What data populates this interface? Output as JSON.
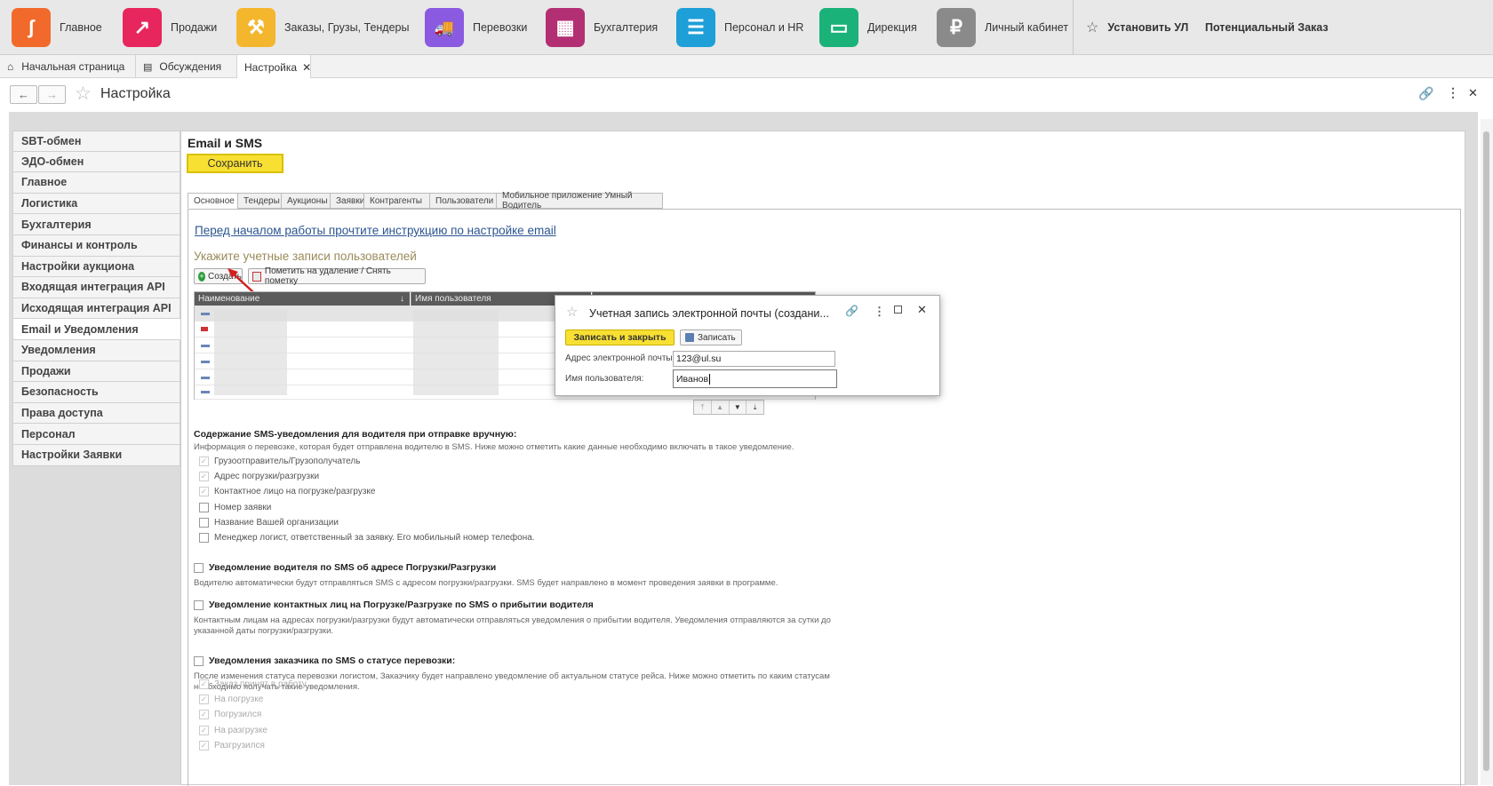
{
  "topbar": {
    "modules": [
      {
        "label": "Главное",
        "icon": "swirl-logo-icon",
        "color": "#f26a2b",
        "glyph": "ʃ"
      },
      {
        "label": "Продажи",
        "icon": "chart-up-icon",
        "color": "#e8265e",
        "glyph": "↗"
      },
      {
        "label": "Заказы,  Грузы, Тендеры",
        "icon": "gavel-icon",
        "color": "#f4b62d",
        "glyph": "⚒"
      },
      {
        "label": "Перевозки",
        "icon": "truck-icon",
        "color": "#8a5be0",
        "glyph": "🚚"
      },
      {
        "label": "Бухгалтерия",
        "icon": "calculator-icon",
        "color": "#b32f73",
        "glyph": "▦"
      },
      {
        "label": "Персонал и HR",
        "icon": "id-card-icon",
        "color": "#1e9fd8",
        "glyph": "☰"
      },
      {
        "label": "Дирекция",
        "icon": "briefcase-icon",
        "color": "#1bb27a",
        "glyph": "▭"
      },
      {
        "label": "Личный кабинет",
        "icon": "lock-ruble-icon",
        "color": "#8a8a8a",
        "glyph": "₽"
      }
    ],
    "install_label": "Установить УЛ",
    "potential_label": "Потенциальный Заказ"
  },
  "open_tabs": [
    "Начальная страница",
    "Обсуждения",
    "Настройка"
  ],
  "header": {
    "title": "Настройка"
  },
  "sidebar": {
    "items": [
      "SBT-обмен",
      "ЭДО-обмен",
      "Главное",
      "Логистика",
      "Бухгалтерия",
      "Финансы и контроль",
      "Настройки аукциона",
      "Входящая интеграция API",
      "Исходящая интеграция API",
      "Email и Уведомления",
      "Уведомления",
      "Продажи",
      "Безопасность",
      "Права доступа",
      "Персонал",
      "Настройки Заявки"
    ],
    "active_index": 9
  },
  "form": {
    "title": "Email и SMS",
    "save_label": "Сохранить",
    "tabs": [
      "Основное",
      "Тендеры",
      "Аукционы",
      "Заявки",
      "Контрагенты",
      "Пользователи",
      "Мобильное приложение Умный Водитель"
    ],
    "instruction_link": "Перед началом работы прочтите инструкцию по настройке email",
    "accounts_heading": "Укажите учетные записи пользователей",
    "create_label": "Создать",
    "mark_label": "Пометить на удаление / Снять пометку",
    "table_columns": [
      "Наименование",
      "Имя пользователя"
    ],
    "sms_heading": "Содержание SMS-уведомления для водителя при отправке вручную:",
    "sms_note": "Информация о перевозке, которая будет отправлена водителю в SMS. Ниже можно отметить какие данные необходимо включать в такое уведомление.",
    "sms_options": [
      {
        "label": "Грузоотправитель/Грузополучатель",
        "checked": true
      },
      {
        "label": "Адрес погрузки/разгрузки",
        "checked": true
      },
      {
        "label": "Контактное лицо на погрузке/разгрузке",
        "checked": true
      },
      {
        "label": "Номер заявки",
        "checked": false
      },
      {
        "label": "Название Вашей организации",
        "checked": false
      },
      {
        "label": "Менеджер логист, ответственный за заявку. Его мобильный номер телефона.",
        "checked": false
      }
    ],
    "driver_notify_heading": "Уведомление водителя по SMS об адресе Погрузки/Разгрузки",
    "driver_notify_note": "Водителю автоматически будут отправляться SMS с адресом погрузки/разгрузки. SMS будет направлено в момент проведения заявки в программе.",
    "contacts_heading": "Уведомление контактных лиц на Погрузке/Разгрузке по SMS о прибытии водителя",
    "contacts_note": "Контактным лицам на адресах погрузки/разгрузки будут автоматически отправляться уведомления о прибытии водителя. Уведомления отправляются за сутки до указанной даты погрузки/разгрузки.",
    "customer_heading": "Уведомления заказчика по SMS о статусе перевозки:",
    "customer_note": "После изменения статуса перевозки логистом, Заказчику будет направлено уведомление об актуальном статусе рейса. Ниже можно отметить по каким статусам необходимо получать такие уведомления.",
    "customer_options": [
      "Заказ принят в работу",
      "На погрузке",
      "Погрузился",
      "На разгрузке",
      "Разгрузился"
    ]
  },
  "dialog": {
    "title": "Учетная запись электронной почты (создани...",
    "write_close_label": "Записать и закрыть",
    "write_label": "Записать",
    "email_label": "Адрес электронной почты:",
    "email_value": "123@ul.su",
    "username_label": "Имя пользователя:",
    "username_value": "Иванов"
  }
}
